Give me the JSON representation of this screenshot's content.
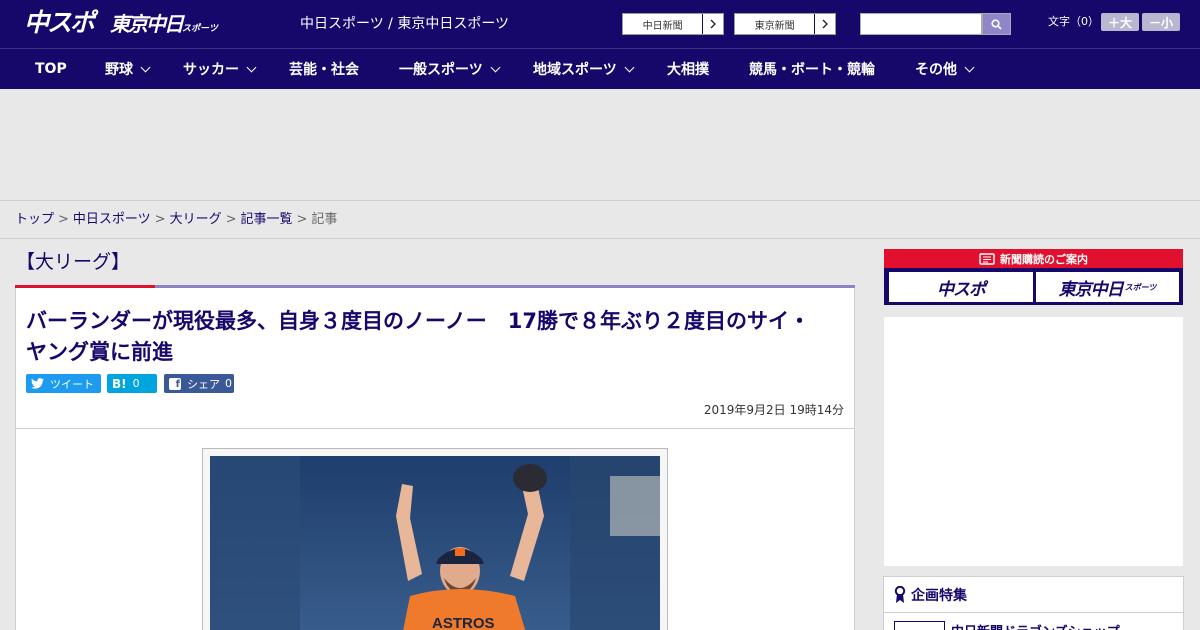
{
  "header": {
    "logo_main": "中スポ",
    "logo_sub": "東京中日",
    "logo_sub_small": "スポーツ",
    "site_title": "中日スポーツ / 東京中日スポーツ",
    "links": [
      {
        "label": "中日新聞"
      },
      {
        "label": "東京新聞"
      }
    ],
    "search": {
      "value": "",
      "placeholder": ""
    },
    "font_size_label": "文字（0）",
    "font_larger": "＋大",
    "font_smaller": "－小"
  },
  "nav": {
    "items": [
      {
        "label": "TOP",
        "dropdown": false
      },
      {
        "label": "野球",
        "dropdown": true
      },
      {
        "label": "サッカー",
        "dropdown": true
      },
      {
        "label": "芸能・社会",
        "dropdown": false
      },
      {
        "label": "一般スポーツ",
        "dropdown": true
      },
      {
        "label": "地域スポーツ",
        "dropdown": true
      },
      {
        "label": "大相撲",
        "dropdown": false
      },
      {
        "label": "競馬・ボート・競輪",
        "dropdown": false
      },
      {
        "label": "その他",
        "dropdown": true
      }
    ]
  },
  "breadcrumb": {
    "items": [
      "トップ",
      "中日スポーツ",
      "大リーグ",
      "記事一覧"
    ],
    "current": "記事",
    "separator": ">"
  },
  "article": {
    "category": "【大リーグ】",
    "headline": "バーランダーが現役最多、自身３度目のノーノー　17勝で８年ぶり２度目のサイ・ヤング賞に前進",
    "share": {
      "tweet_label": "ツイート",
      "hatena_count": "0",
      "facebook_label": "シェア",
      "facebook_count": "0"
    },
    "date": "2019年9月2日 19時14分",
    "photo_jersey_text": "ASTROS"
  },
  "sidebar": {
    "promo": {
      "title": "新聞購読のご案内",
      "tiles": [
        {
          "label": "中スポ",
          "small": ""
        },
        {
          "label": "東京中日",
          "small": "スポーツ"
        }
      ]
    },
    "feature": {
      "title": "企画特集",
      "first_item": "中日新聞ドラゴンズショップ"
    }
  },
  "colors": {
    "brand_navy": "#16086b",
    "accent_red": "#e0102e",
    "twitter": "#1d9bf0",
    "hatena": "#00a4de",
    "facebook": "#3b5998"
  }
}
